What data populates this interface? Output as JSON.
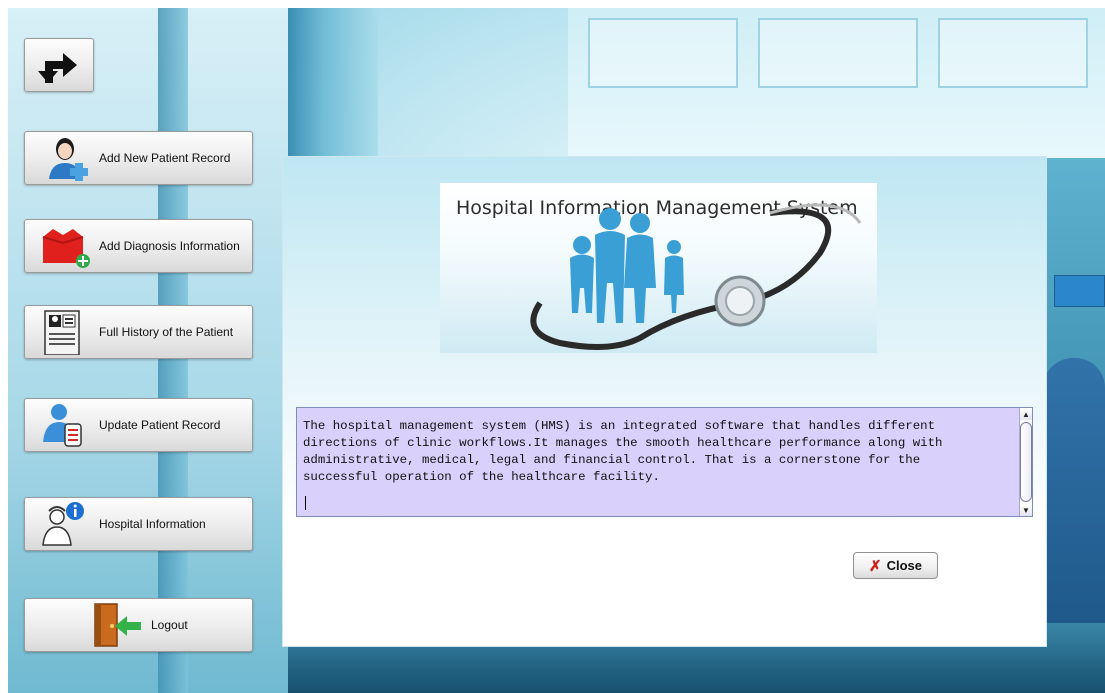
{
  "nav": {
    "back_icon": "turn-arrow-icon",
    "items": [
      {
        "label": "Add New Patient Record",
        "icon": "add-patient-icon"
      },
      {
        "label": "Add Diagnosis Information",
        "icon": "add-diagnosis-icon"
      },
      {
        "label": "Full History of the Patient",
        "icon": "patient-history-icon"
      },
      {
        "label": "Update Patient Record",
        "icon": "update-record-icon"
      },
      {
        "label": "Hospital Information",
        "icon": "hospital-info-icon"
      },
      {
        "label": "Logout",
        "icon": "logout-door-icon"
      }
    ]
  },
  "dialog": {
    "banner_title": "Hospital Information Management System",
    "info_text": "The hospital management system (HMS) is an integrated software that handles different\ndirections of clinic workflows.It manages the smooth healthcare performance along with\nadministrative, medical, legal and financial control. That is a cornerstone for the\nsuccessful operation of the healthcare facility.",
    "close_label": "Close"
  },
  "colors": {
    "info_box_bg": "#d9d0fb",
    "close_x": "#d0201a",
    "sky": "#8fd0e4"
  }
}
